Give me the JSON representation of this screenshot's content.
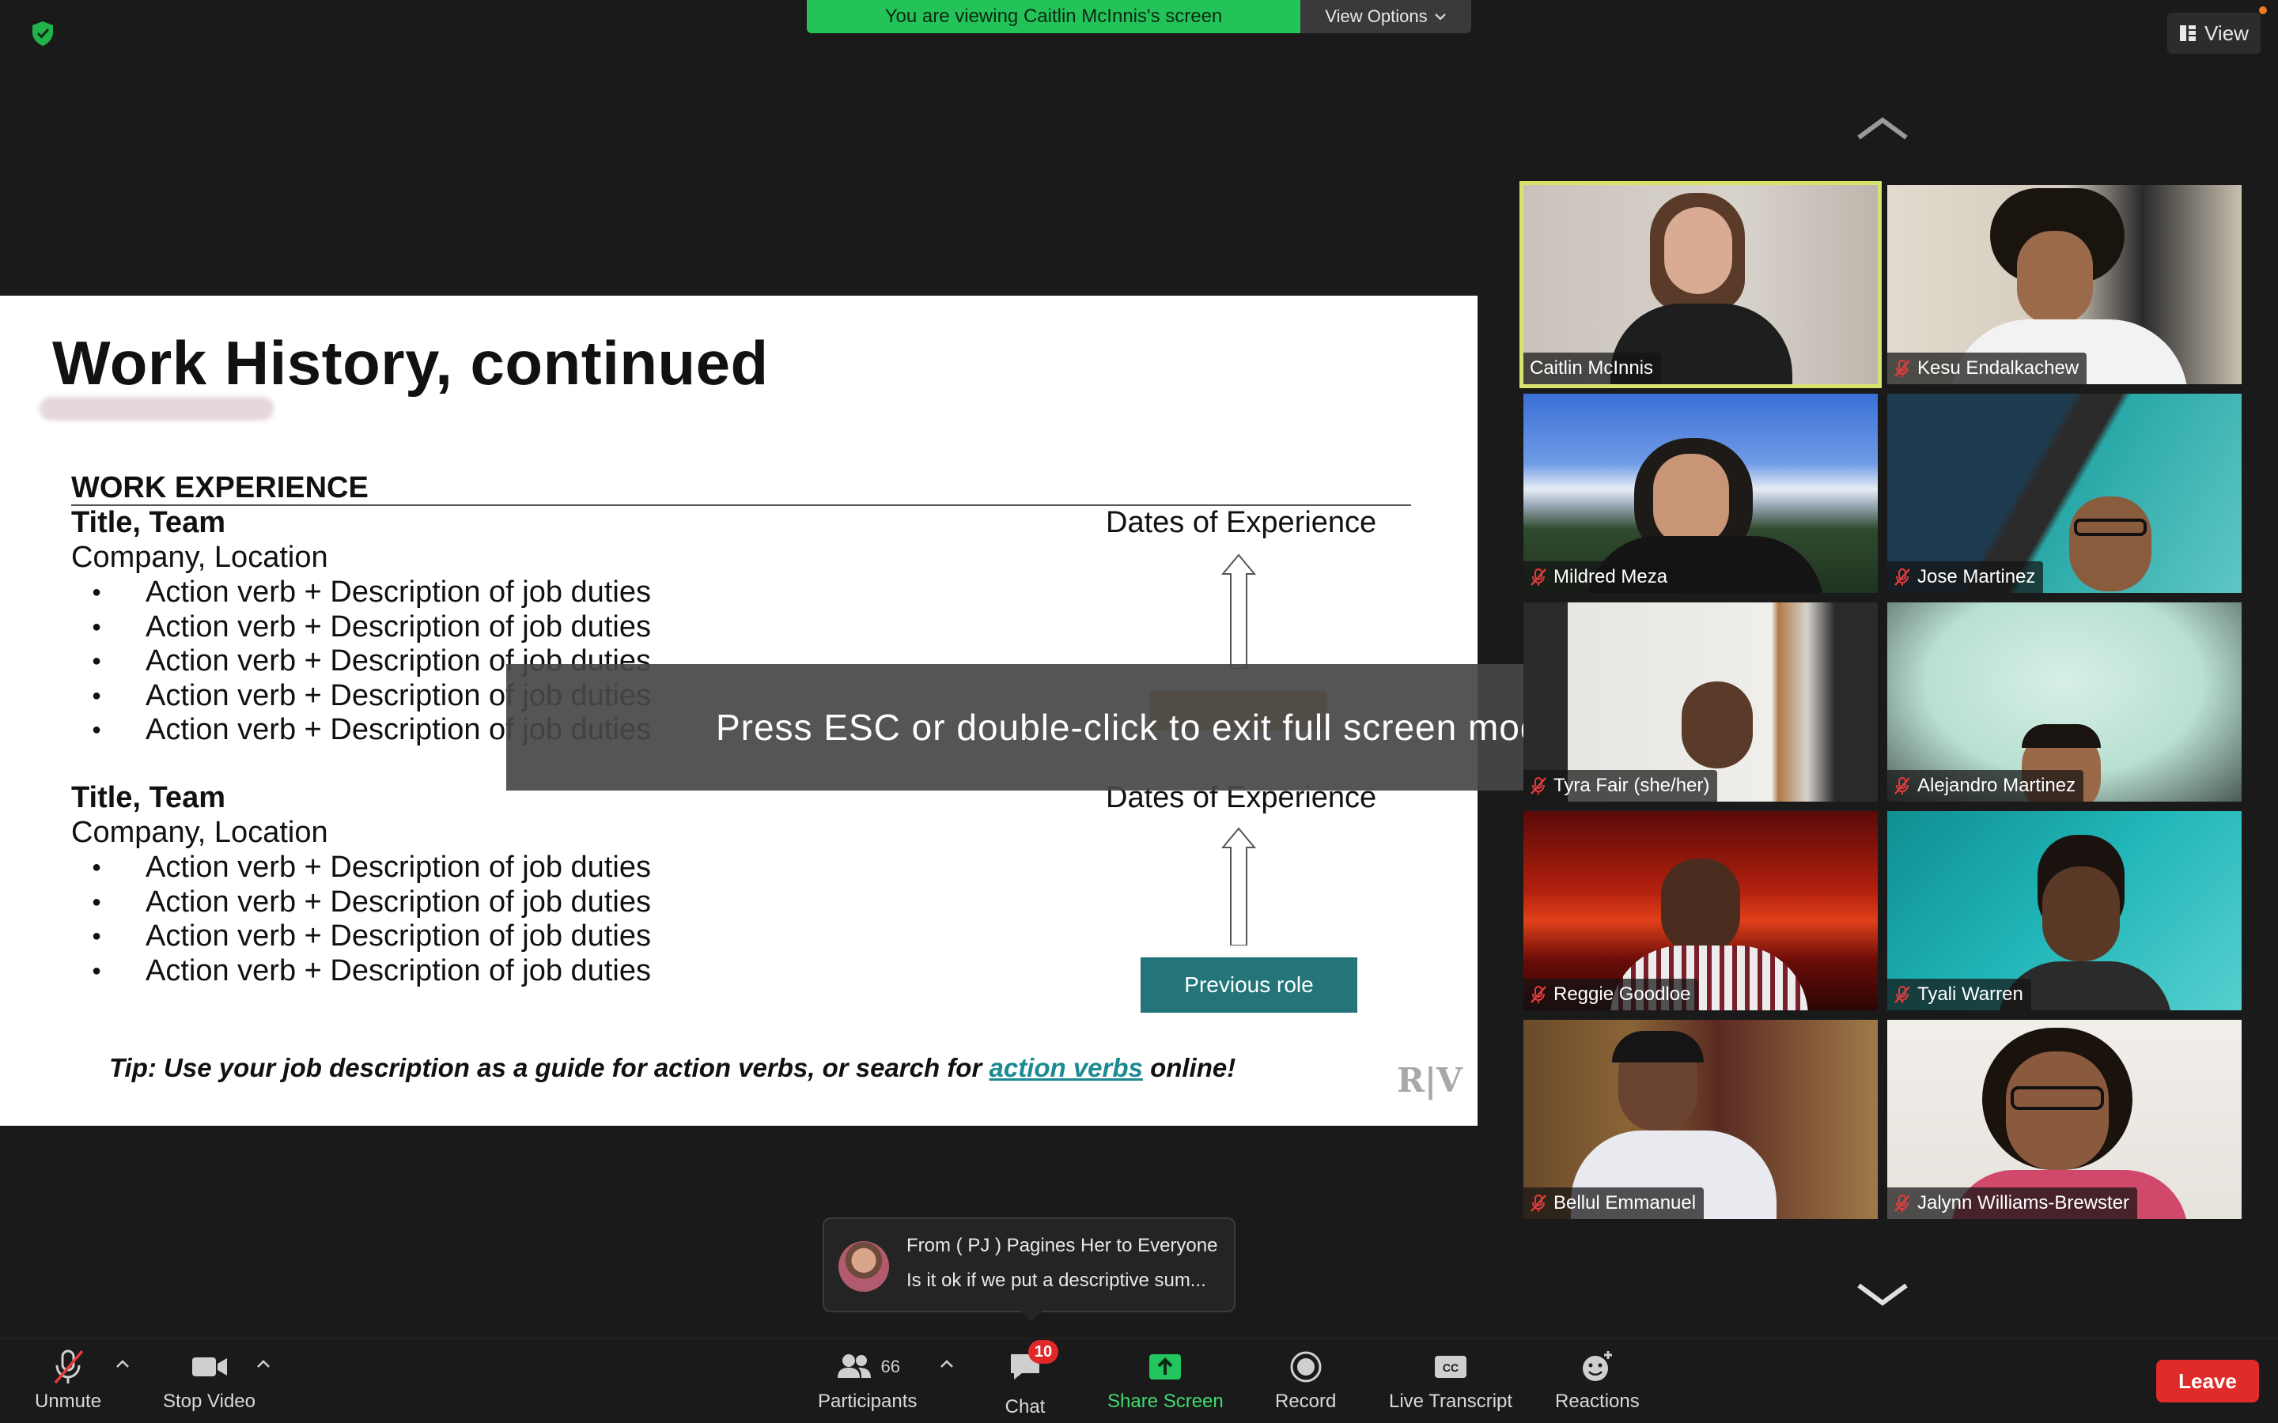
{
  "top": {
    "viewing_banner": "You are viewing Caitlin McInnis's screen",
    "view_options": "View Options",
    "view_button": "View"
  },
  "slide": {
    "title": "Work History, continued",
    "section_heading": "WORK EXPERIENCE",
    "roles": [
      {
        "title": "Title, Team",
        "company": "Company, Location",
        "dates": "Dates of Experience",
        "bullets": [
          "Action verb + Description of job duties",
          "Action verb + Description of job duties",
          "Action verb + Description of job duties",
          "Action verb + Description of job duties",
          "Action verb + Description of job duties"
        ]
      },
      {
        "title": "Title, Team",
        "company": "Company, Location",
        "dates": "Dates of Experience",
        "bullets": [
          "Action verb + Description of job duties",
          "Action verb + Description of job duties",
          "Action verb + Description of job duties",
          "Action verb + Description of job duties"
        ]
      }
    ],
    "previous_role_label": "Previous role",
    "tip_prefix": "Tip: Use your job description as a guide for action verbs, or search for ",
    "tip_link": "action verbs",
    "tip_suffix": " online!",
    "logo_text": "R|V"
  },
  "overlay": {
    "esc_message": "Press ESC or double-click to exit full screen mode"
  },
  "participants_grid": [
    {
      "name": "Caitlin McInnis",
      "muted": false,
      "active": true
    },
    {
      "name": "Kesu Endalkachew",
      "muted": true,
      "active": false
    },
    {
      "name": "Mildred Meza",
      "muted": true,
      "active": false
    },
    {
      "name": "Jose Martinez",
      "muted": true,
      "active": false
    },
    {
      "name": "Tyra Fair (she/her)",
      "muted": true,
      "active": false
    },
    {
      "name": "Alejandro Martinez",
      "muted": true,
      "active": false
    },
    {
      "name": "Reggie Goodloe",
      "muted": true,
      "active": false
    },
    {
      "name": "Tyali Warren",
      "muted": true,
      "active": false
    },
    {
      "name": "Bellul Emmanuel",
      "muted": true,
      "active": false
    },
    {
      "name": "Jalynn Williams-Brewster",
      "muted": true,
      "active": false
    }
  ],
  "chat_toast": {
    "from": "From ( PJ ) Pagines Her to Everyone",
    "message": "Is it ok if we put a descriptive sum..."
  },
  "toolbar": {
    "unmute": "Unmute",
    "stop_video": "Stop Video",
    "participants": "Participants",
    "participants_count": "66",
    "chat": "Chat",
    "chat_badge": "10",
    "share_screen": "Share Screen",
    "record": "Record",
    "live_transcript": "Live Transcript",
    "reactions": "Reactions",
    "leave": "Leave"
  },
  "colors": {
    "banner_green": "#23c35a",
    "active_speaker": "#d8e36e",
    "slide_teal": "#23757a",
    "leave_red": "#e02b2b",
    "share_green": "#22c55e"
  }
}
